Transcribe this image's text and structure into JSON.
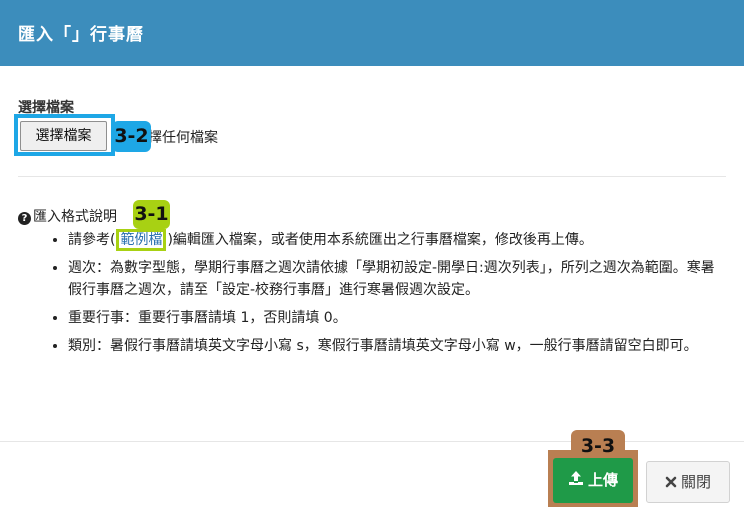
{
  "modal": {
    "title": "匯入「」行事曆"
  },
  "file_field": {
    "label": "選擇檔案",
    "button_label": "選擇檔案",
    "status_text": "擇任何檔案"
  },
  "annotations": {
    "badge_3_1": "3-1",
    "badge_3_2": "3-2",
    "badge_3_3": "3-3"
  },
  "format": {
    "title": "匯入格式說明",
    "rules": {
      "r1_prefix": "請參考(",
      "r1_link": "範例檔",
      "r1_suffix": ")編輯匯入檔案，或者使用本系統匯出之行事曆檔案，修改後再上傳。",
      "r2": "週次：為數字型態，學期行事曆之週次請依據「學期初設定-開學日:週次列表」，所列之週次為範圍。寒暑假行事曆之週次，請至「設定-校務行事曆」進行寒暑假週次設定。",
      "r3": "重要行事：重要行事曆請填 1，否則請填 0。",
      "r4": "類別：暑假行事曆請填英文字母小寫 s，寒假行事曆請填英文字母小寫 w，一般行事曆請留空白即可。"
    }
  },
  "footer": {
    "upload_label": "上傳",
    "close_label": "關閉"
  },
  "icons": {
    "question": "question-circle-icon",
    "upload": "upload-icon",
    "close": "close-icon"
  },
  "colors": {
    "header_bg": "#3c8dbc",
    "upload_bg": "#1f9a48",
    "annotation_blue": "#1ea7e6",
    "annotation_green": "#a8d113",
    "annotation_brown": "#b97f52"
  }
}
